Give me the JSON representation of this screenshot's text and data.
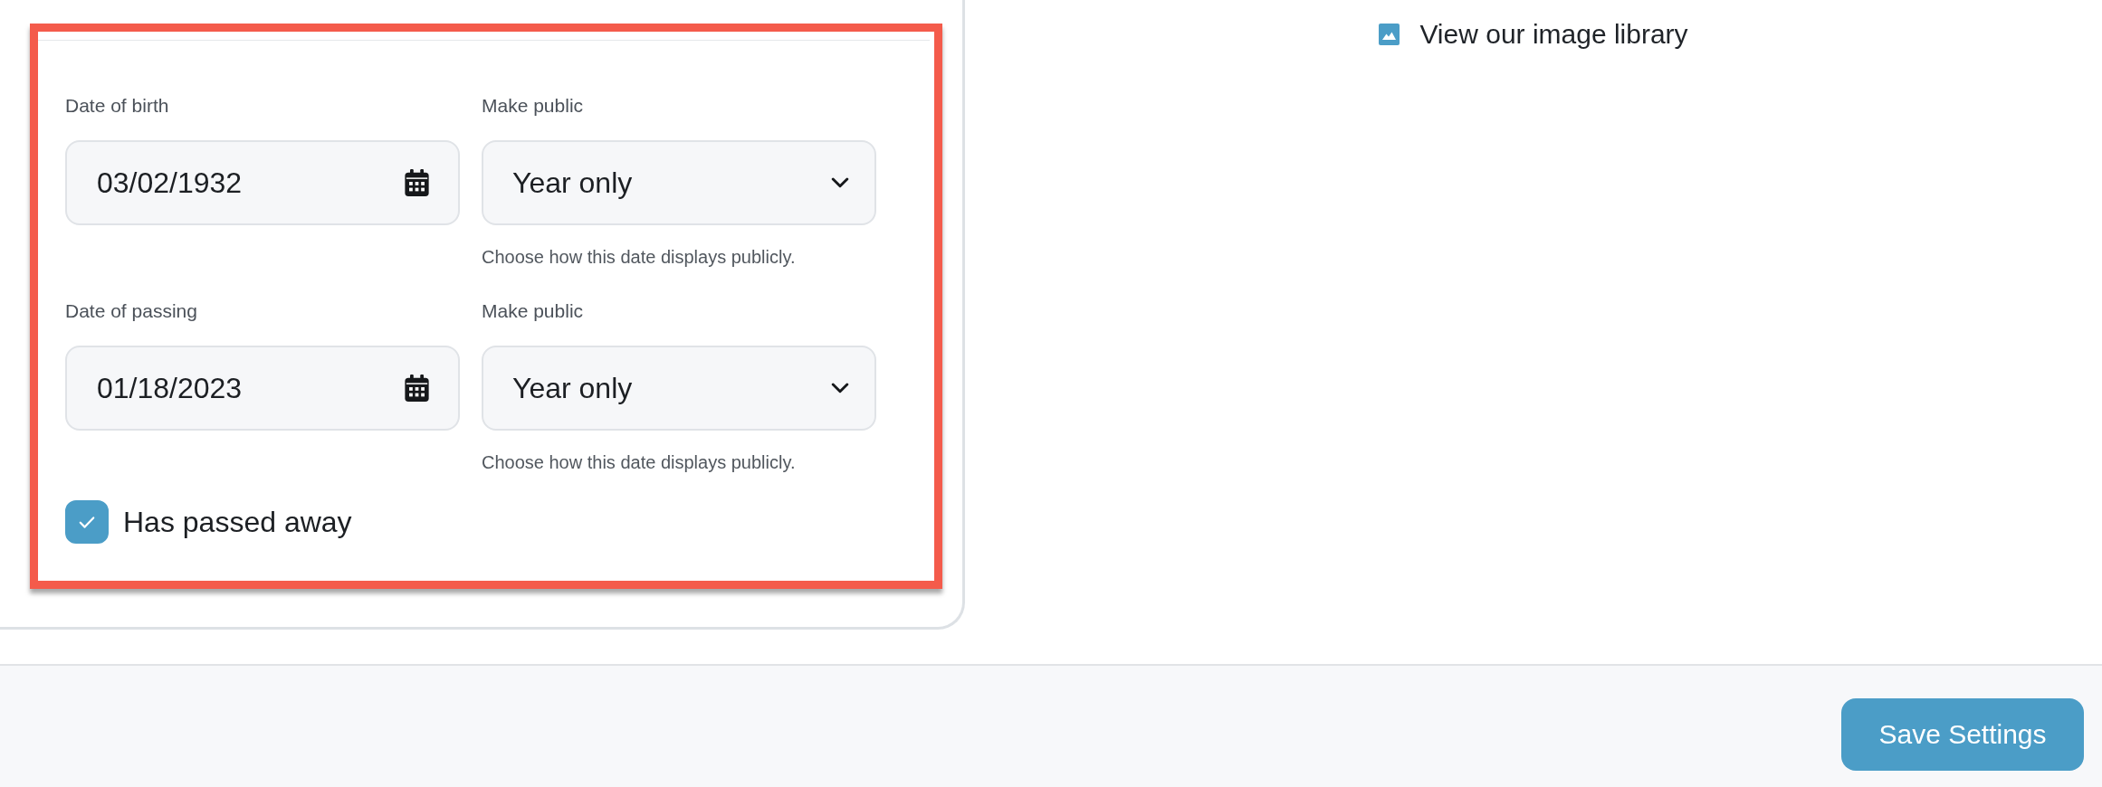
{
  "date_fields": [
    {
      "label": "Date of birth",
      "value": "03/02/1932",
      "visibility": {
        "label": "Make public",
        "value": "Year only",
        "help": "Choose how this date displays publicly."
      }
    },
    {
      "label": "Date of passing",
      "value": "01/18/2023",
      "visibility": {
        "label": "Make public",
        "value": "Year only",
        "help": "Choose how this date displays publicly."
      }
    }
  ],
  "passed_away": {
    "label": "Has passed away",
    "checked": true
  },
  "image_link": {
    "label": "View our image library"
  },
  "footer": {
    "buttons": [
      "Save Settings"
    ]
  }
}
